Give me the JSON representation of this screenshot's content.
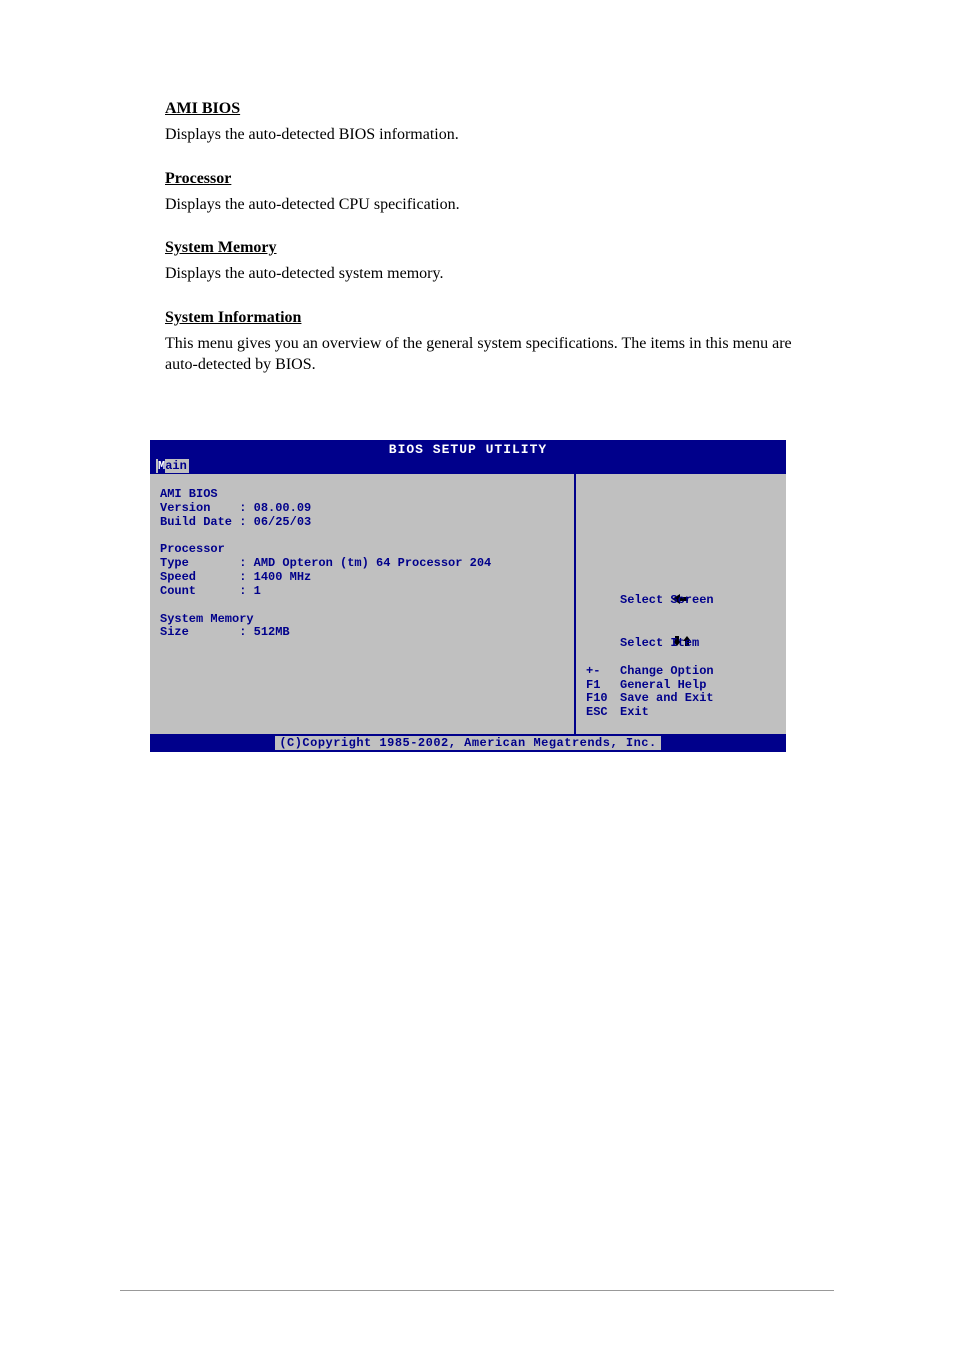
{
  "sections": {
    "ami": {
      "heading": "AMI BIOS",
      "text": "Displays the auto-detected BIOS information."
    },
    "processor": {
      "heading": "Processor",
      "text": "Displays the auto-detected CPU specification."
    },
    "memory": {
      "heading": "System Memory",
      "text": "Displays the auto-detected system memory."
    },
    "info": {
      "heading": "System Information",
      "text": "This menu gives you an overview of the general system specifications. The items in this menu are auto-detected by BIOS."
    }
  },
  "bios": {
    "title": "BIOS SETUP UTILITY",
    "tab": "Main",
    "left": {
      "ami_header": "AMI BIOS",
      "version_line": "Version    : 08.00.09",
      "build_line": "Build Date : 06/25/03",
      "proc_header": "Processor",
      "type_line": "Type       : AMD Opteron (tm) 64 Processor 204",
      "speed_line": "Speed      : 1400 MHz",
      "count_line": "Count      : 1",
      "mem_header": "System Memory",
      "size_line": "Size       : 512MB"
    },
    "help": {
      "select_screen": "Select Screen",
      "select_item": "Select Item",
      "change_option": {
        "key": "+-",
        "label": "Change Option"
      },
      "general_help": {
        "key": "F1",
        "label": "General Help"
      },
      "save_exit": {
        "key": "F10",
        "label": "Save and Exit"
      },
      "exit": {
        "key": "ESC",
        "label": "Exit"
      }
    },
    "footer": "(C)Copyright 1985-2002, American Megatrends, Inc."
  }
}
